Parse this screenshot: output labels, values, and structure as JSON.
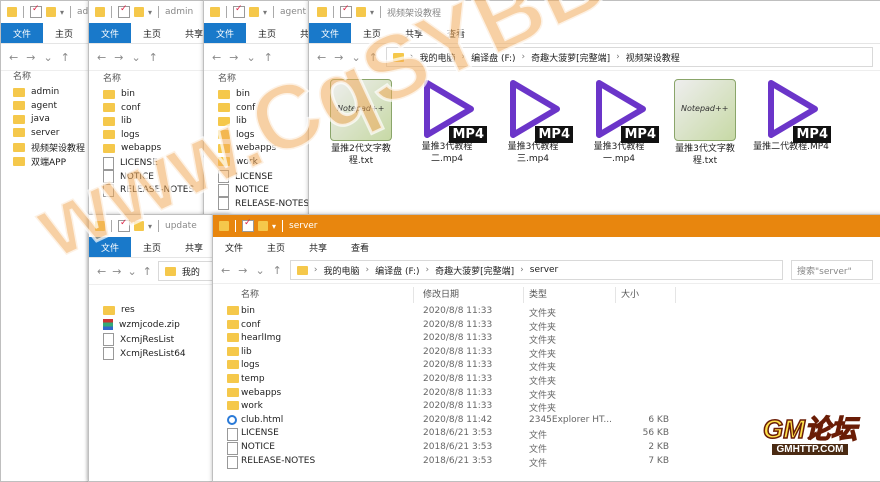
{
  "colors": {
    "accent": "#1979ca",
    "folder": "#f5c84b",
    "watermark": "#f0aa5a"
  },
  "window_admin": {
    "title": "admin",
    "ribbon": [
      "文件",
      "主页"
    ],
    "sidebar_header": "名称",
    "items": [
      {
        "name": "admin",
        "icon": "folder-icon"
      },
      {
        "name": "agent",
        "icon": "folder-icon"
      },
      {
        "name": "java",
        "icon": "folder-icon"
      },
      {
        "name": "server",
        "icon": "folder-icon"
      },
      {
        "name": "视频架设教程",
        "icon": "folder-icon"
      },
      {
        "name": "双端APP",
        "icon": "folder-icon"
      }
    ]
  },
  "window_admin2": {
    "title": "admin",
    "ribbon": [
      "文件",
      "主页",
      "共享"
    ],
    "header": "名称",
    "items": [
      {
        "name": "bin",
        "icon": "folder-icon"
      },
      {
        "name": "conf",
        "icon": "folder-icon"
      },
      {
        "name": "lib",
        "icon": "folder-icon"
      },
      {
        "name": "logs",
        "icon": "folder-icon"
      },
      {
        "name": "webapps",
        "icon": "folder-icon"
      },
      {
        "name": "LICENSE",
        "icon": "file-icon"
      },
      {
        "name": "NOTICE",
        "icon": "file-icon"
      },
      {
        "name": "RELEASE-NOTES",
        "icon": "file-icon"
      }
    ]
  },
  "window_agent": {
    "title": "agent",
    "ribbon": [
      "文件",
      "主页",
      "共享"
    ],
    "header": "名称",
    "items": [
      {
        "name": "bin",
        "icon": "folder-icon"
      },
      {
        "name": "conf",
        "icon": "folder-icon"
      },
      {
        "name": "lib",
        "icon": "folder-icon"
      },
      {
        "name": "logs",
        "icon": "folder-icon"
      },
      {
        "name": "webapps",
        "icon": "folder-icon"
      },
      {
        "name": "work",
        "icon": "folder-icon"
      },
      {
        "name": "LICENSE",
        "icon": "file-icon"
      },
      {
        "name": "NOTICE",
        "icon": "file-icon"
      },
      {
        "name": "RELEASE-NOTES",
        "icon": "file-icon"
      }
    ]
  },
  "window_video": {
    "title": "视频架设教程",
    "ribbon": [
      "文件",
      "主页",
      "共享",
      "查看"
    ],
    "breadcrumb": [
      "我的电脑",
      "编译盘 (F:)",
      "奇趣大菠萝[完整端]",
      "视频架设教程"
    ],
    "tiles": [
      {
        "name": "量推2代文字教程.txt",
        "kind": "txt",
        "icon": "notepad-icon"
      },
      {
        "name": "量推3代教程二.mp4",
        "kind": "mp4",
        "icon": "video-play-icon",
        "badge": "MP4"
      },
      {
        "name": "量推3代教程三.mp4",
        "kind": "mp4",
        "icon": "video-play-icon",
        "badge": "MP4"
      },
      {
        "name": "量推3代教程一.mp4",
        "kind": "mp4",
        "icon": "video-play-icon",
        "badge": "MP4"
      },
      {
        "name": "量推3代文字教程.txt",
        "kind": "txt",
        "icon": "notepad-icon"
      },
      {
        "name": "量推二代教程.MP4",
        "kind": "mp4",
        "icon": "video-play-icon",
        "badge": "MP4"
      }
    ]
  },
  "window_update": {
    "title": "update",
    "ribbon": [
      "文件",
      "主页",
      "共享"
    ],
    "breadcrumb_partial": "我的",
    "items": [
      {
        "name": "res",
        "icon": "folder-icon"
      },
      {
        "name": "wzmjcode.zip",
        "icon": "zip-icon"
      },
      {
        "name": "XcmjResList",
        "icon": "file-icon"
      },
      {
        "name": "XcmjResList64",
        "icon": "file-icon"
      }
    ]
  },
  "window_server": {
    "title": "server",
    "ribbon": [
      "文件",
      "主页",
      "共享",
      "查看"
    ],
    "breadcrumb": [
      "我的电脑",
      "编译盘 (F:)",
      "奇趣大菠萝[完整端]",
      "server"
    ],
    "search_placeholder": "搜索\"server\"",
    "columns": [
      "名称",
      "修改日期",
      "类型",
      "大小"
    ],
    "rows": [
      {
        "name": "bin",
        "icon": "folder-icon",
        "date": "2020/8/8 11:33",
        "type": "文件夹",
        "size": ""
      },
      {
        "name": "conf",
        "icon": "folder-icon",
        "date": "2020/8/8 11:33",
        "type": "文件夹",
        "size": ""
      },
      {
        "name": "hearlImg",
        "icon": "folder-icon",
        "date": "2020/8/8 11:33",
        "type": "文件夹",
        "size": ""
      },
      {
        "name": "lib",
        "icon": "folder-icon",
        "date": "2020/8/8 11:33",
        "type": "文件夹",
        "size": ""
      },
      {
        "name": "logs",
        "icon": "folder-icon",
        "date": "2020/8/8 11:33",
        "type": "文件夹",
        "size": ""
      },
      {
        "name": "temp",
        "icon": "folder-icon",
        "date": "2020/8/8 11:33",
        "type": "文件夹",
        "size": ""
      },
      {
        "name": "webapps",
        "icon": "folder-icon",
        "date": "2020/8/8 11:33",
        "type": "文件夹",
        "size": ""
      },
      {
        "name": "work",
        "icon": "folder-icon",
        "date": "2020/8/8 11:33",
        "type": "文件夹",
        "size": ""
      },
      {
        "name": "club.html",
        "icon": "browser-icon",
        "date": "2020/8/8 11:42",
        "type": "2345Explorer HT...",
        "size": "6 KB"
      },
      {
        "name": "LICENSE",
        "icon": "file-icon",
        "date": "2018/6/21 3:53",
        "type": "文件",
        "size": "56 KB"
      },
      {
        "name": "NOTICE",
        "icon": "file-icon",
        "date": "2018/6/21 3:53",
        "type": "文件",
        "size": "2 KB"
      },
      {
        "name": "RELEASE-NOTES",
        "icon": "file-icon",
        "date": "2018/6/21 3:53",
        "type": "文件",
        "size": "7 KB"
      }
    ]
  },
  "watermark": "www.CqSYBB.com",
  "logo": {
    "big": "GM论坛",
    "small": "GMHTTP.COM"
  }
}
